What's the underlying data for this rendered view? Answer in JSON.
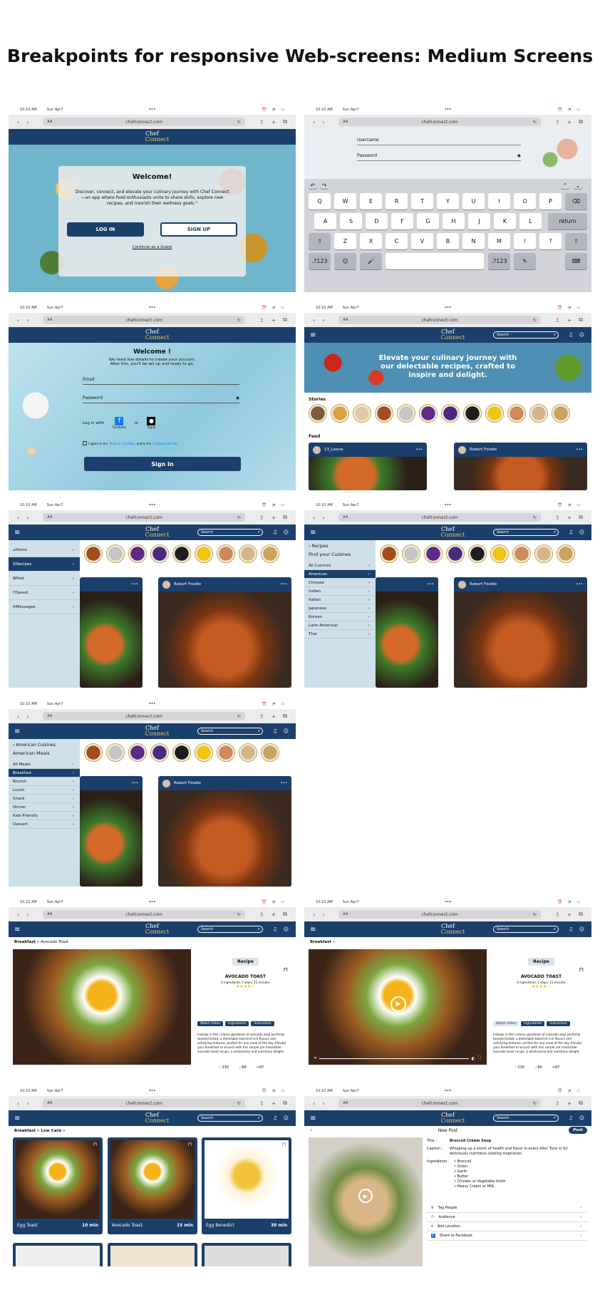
{
  "title": "Breakpoints for responsive Web-screens: Medium Screens",
  "status": {
    "time": "10:10 AM",
    "date": "Sun Apr7",
    "dots": "•••"
  },
  "browser": {
    "url": "chefconnect.com",
    "aa": "AA"
  },
  "logo": {
    "line1": "Chef",
    "line2": "Connect"
  },
  "search_placeholder": "Search",
  "colors": {
    "navy": "#1b3f6b",
    "gold": "#e8c766",
    "menu_bg": "#cfe0ea"
  },
  "welcome": {
    "heading": "Welcome!",
    "body": "Discover, connect, and elevate your culinary journey with Chef Connect—an app where food enthusiasts unite to share skills, explore new recipes, and nourish their wellness goals.\"",
    "login": "LOG IN",
    "signup": "SIGN UP",
    "guest": "Continue as a Guest"
  },
  "login_form": {
    "username": "Username",
    "password": "Password"
  },
  "keyboard": {
    "row1": [
      "Q",
      "W",
      "E",
      "R",
      "T",
      "Y",
      "U",
      "I",
      "O",
      "P"
    ],
    "row2": [
      "A",
      "S",
      "D",
      "F",
      "G",
      "H",
      "J",
      "K",
      "L"
    ],
    "row3": [
      "Z",
      "X",
      "C",
      "V",
      "B",
      "N",
      "M",
      "!",
      "?"
    ],
    "return": "return",
    "num": ".?123"
  },
  "signup_form": {
    "heading": "Welcome !",
    "sub1": "We need few details to create your account.",
    "sub2": "After this, you'll be set up and ready to go.",
    "email": "Email",
    "password": "Password",
    "login_with": "Log in with",
    "or": "or",
    "facebook": "Facebook",
    "apple": "Apple",
    "agree_pre": "I agree to the",
    "terms": "Terms & Condition",
    "agree_mid": "and to the",
    "policy": "Company Policies",
    "signin": "Sign In"
  },
  "feed": {
    "banner": "Elevate your culinary journey with our delectable recipes, crafted to inspire and delight.",
    "stories_label": "Stories",
    "feed_label": "Feed",
    "user1": "13_Leena",
    "user2": "Robert Foodie",
    "more": "•••"
  },
  "main_menu": [
    "Home",
    "Recipes",
    "Post",
    "Saved",
    "Messages"
  ],
  "cuisines": {
    "back": "Recipes",
    "title": "Find your Cuisines",
    "items": [
      "All Cuisines",
      "American",
      "Chinese",
      "Indian",
      "Italian",
      "Japanese",
      "Korean",
      "Latin-American",
      "Thai"
    ]
  },
  "meals": {
    "back": "American Cuisines",
    "title": "American Meals",
    "items": [
      "All Meals",
      "Breakfast",
      "Brunch",
      "Lunch",
      "Snack",
      "Dinner",
      "Kids-Friendly",
      "Dessert"
    ]
  },
  "recipe": {
    "breadcrumb_a": "Breakfast",
    "breadcrumb_b": "Avocado Toast",
    "breadcrumb_sep": "»",
    "badge": "Recipe",
    "name": "AVOCADO TOAST",
    "meta": "6 ingredients, 5 steps, 15 minutes",
    "stars": "★★★★☆",
    "tabs": [
      "Watch Video",
      "Ingredients",
      "Instruction"
    ],
    "desc": "Indulge in the creamy goodness of avocado atop perfectly toasted bread, a delectable blend of rich flavors and satisfying textures, perfect for any meal of the day. Elevate your breakfast or brunch with this simple yet irresistible avocado toast recipe, a wholesome and nutritious delight.",
    "likes": "230",
    "comments": "66",
    "shares": "97"
  },
  "grid": {
    "breadcrumb": "Breakfast » Low Carb »",
    "items": [
      {
        "name": "Egg Toast",
        "time": "10 min"
      },
      {
        "name": "Avocado Toast",
        "time": "15 min"
      },
      {
        "name": "Egg Benedict",
        "time": "30 min"
      }
    ]
  },
  "new_post": {
    "title": "New Post",
    "post_btn": "Post",
    "title_label": "Title :",
    "title_val": "Broccoli Cream Soup",
    "caption_label": "Caption :",
    "caption_val": "Whipping up a storm of health and flavor in every bite! Tune in for deliciously nutritious cooking inspiration.",
    "ingredients_label": "Ingredients :",
    "ingredients": [
      "Broccoli",
      "Onion",
      "Garlic",
      "Butter",
      "Chicken or Vegetable broth",
      "Heavy Cream or Milk"
    ],
    "options": [
      "Tag People",
      "Audience",
      "Add Location",
      "Share to Facebook"
    ]
  }
}
